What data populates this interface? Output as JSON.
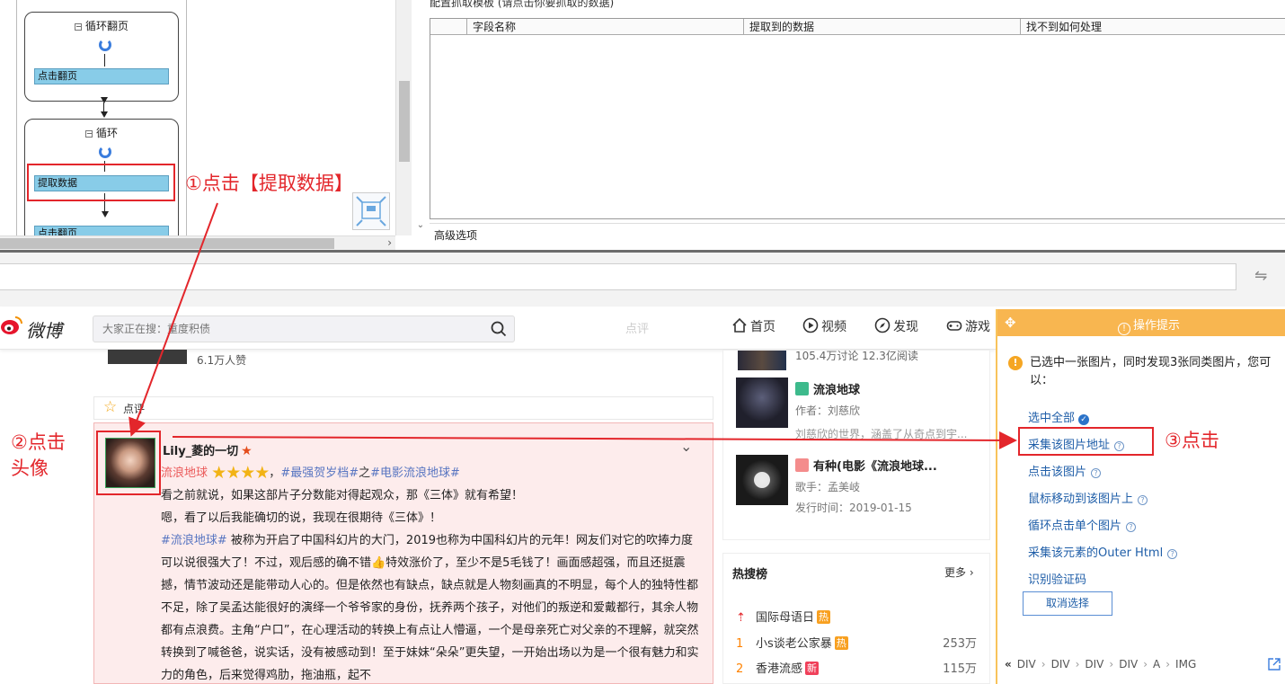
{
  "workflow": {
    "loop_page_title": "循环翻页",
    "click_next_label": "点击翻页",
    "loop_title": "循环",
    "extract_label": "提取数据",
    "next_step_label": "点击翻页"
  },
  "template": {
    "title": "配置抓取模板 (请点击你要抓取的数据)",
    "columns": [
      "字段名称",
      "提取到的数据",
      "找不到如何处理"
    ],
    "advanced": "高级选项"
  },
  "weibo": {
    "logo_text": "微博",
    "search_placeholder": "大家正在搜：重度积债",
    "nav": [
      "首页",
      "视频",
      "发现",
      "游戏"
    ],
    "nav_ghost": "点评",
    "likes_text": "6.1万人赞",
    "comment_section_label": "点评",
    "comment": {
      "username": "Lily_菱的一切",
      "tag_movie": "流浪地球",
      "tag_hot1": "#最强贺岁档#",
      "connector": "之",
      "tag_hot2": "#电影流浪地球#",
      "rating_stars": 4,
      "line_a": "看之前就说，如果这部片子分数能对得起观众，那《三体》就有希望！",
      "line_b": "嗯，看了以后我能确切的说，我现在很期待《三体》！",
      "tag_inline": "#流浪地球#",
      "body": " 被称为开启了中国科幻片的大门，2019也称为中国科幻片的元年！网友们对它的吹捧力度可以说很强大了！不过，观后感的确不错👍特效涨价了，至少不是5毛钱了！画面感超强，而且还挺震撼，情节波动还是能带动人心的。但是依然也有缺点，缺点就是人物刻画真的不明显，每个人的独特性都不足，除了吴孟达能很好的演绎一个爷爷家的身份，抚养两个孩子，对他们的叛逆和爱戴都行，其余人物都有点浪费。主角“户口”，在心理活动的转换上有点让人懵逼，一个是母亲死亡对父亲的不理解，就突然转换到了喊爸爸，说实话，没有被感动到！至于妹妹“朵朵”更失望，一开始出场以为是一个很有魅力和实力的角色，后来觉得鸡肋，拖油瓶，起不"
    },
    "mid": {
      "stats": "105.4万讨论 12.3亿阅读",
      "item1_title": "流浪地球",
      "item1_author": "作者：刘慈欣",
      "item1_desc": "刘慈欣的世界，涵盖了从奇点到宇...",
      "item2_title": "有种(电影《流浪地球...",
      "item2_singer": "歌手：孟美岐",
      "item2_date": "发行时间：2019-01-15"
    },
    "hot": {
      "title": "热搜榜",
      "more": "更多",
      "rows": [
        {
          "rank": "",
          "text": "国际母语日",
          "tag": "热",
          "count": ""
        },
        {
          "rank": "1",
          "text": "小s谈老公家暴",
          "tag": "热",
          "count": "253万"
        },
        {
          "rank": "2",
          "text": "香港流感",
          "tag": "新",
          "count": "115万"
        }
      ]
    }
  },
  "ops_panel": {
    "title": "操作提示",
    "description": "已选中一张图片，同时发现3张同类图片，您可以：",
    "actions": [
      "选中全部",
      "采集该图片地址",
      "点击该图片",
      "鼠标移动到该图片上",
      "循环点击单个图片",
      "采集该元素的Outer Html",
      "识别验证码"
    ],
    "cancel": "取消选择",
    "path": [
      "DIV",
      "DIV",
      "DIV",
      "DIV",
      "A",
      "IMG"
    ]
  },
  "annotations": {
    "step1": "①点击【提取数据】",
    "step2_line1": "②点击",
    "step2_line2": "头像",
    "step3": "③点击"
  },
  "colors": {
    "annotation_red": "#e3262b",
    "panel_orange": "#f8b650",
    "link_blue": "#1f5ea8",
    "step_blue": "#88cce8"
  }
}
